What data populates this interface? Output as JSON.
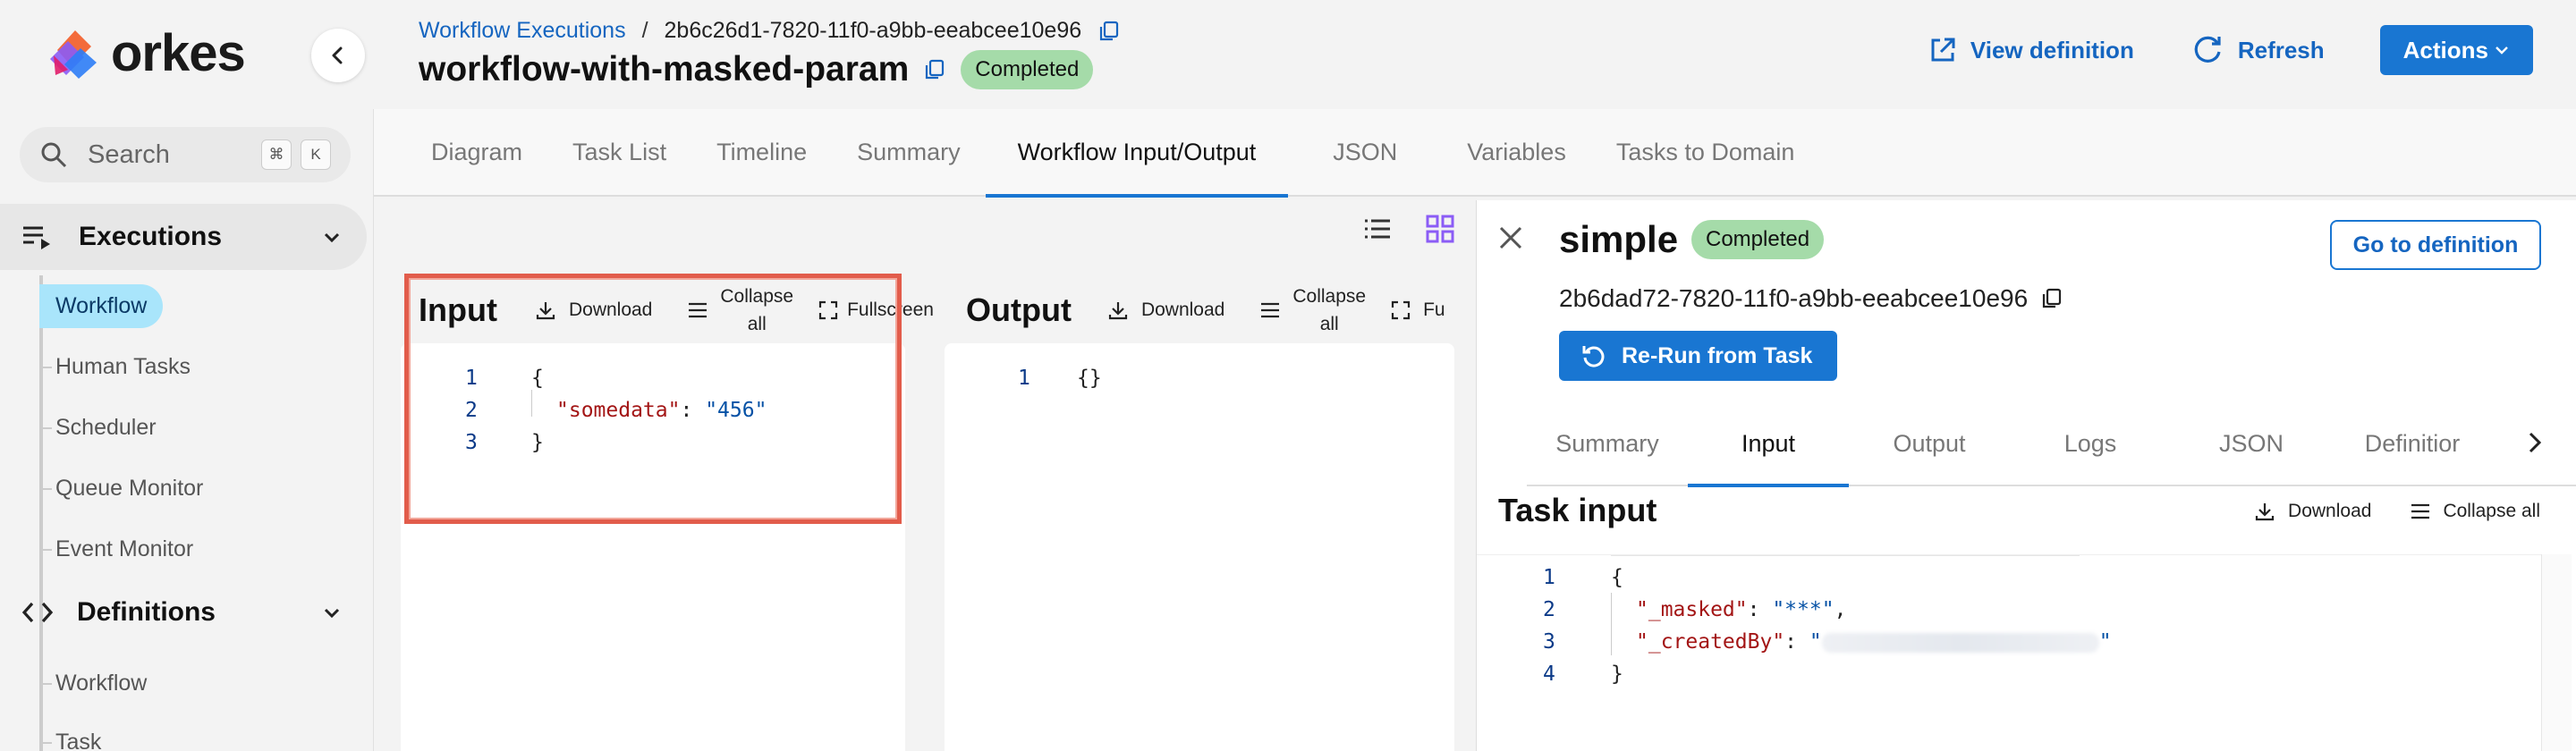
{
  "brand": {
    "name": "orkes"
  },
  "header": {
    "breadcrumb_link": "Workflow Executions",
    "breadcrumb_sep": "/",
    "workflow_id": "2b6c26d1-7820-11f0-a9bb-eeabcee10e96",
    "title": "workflow-with-masked-param",
    "status": "Completed",
    "view_definition": "View definition",
    "refresh": "Refresh",
    "actions": "Actions"
  },
  "sidebar": {
    "search_placeholder": "Search",
    "kbd_cmd": "⌘",
    "kbd_k": "K",
    "executions_label": "Executions",
    "executions_items": [
      "Workflow",
      "Human Tasks",
      "Scheduler",
      "Queue Monitor",
      "Event Monitor"
    ],
    "definitions_label": "Definitions",
    "definitions_items": [
      "Workflow",
      "Task"
    ]
  },
  "tabs": [
    "Diagram",
    "Task List",
    "Timeline",
    "Summary",
    "Workflow Input/Output",
    "JSON",
    "Variables",
    "Tasks to Domain"
  ],
  "input_pane": {
    "title": "Input",
    "download": "Download",
    "collapse_1": "Collapse",
    "collapse_2": "all",
    "fullscreen": "Fullscreen",
    "lines": {
      "n1": "1",
      "n2": "2",
      "n3": "3",
      "open": "{",
      "key": "\"somedata\"",
      "colon": ": ",
      "value": "\"456\"",
      "close": "}"
    }
  },
  "output_pane": {
    "title": "Output",
    "download": "Download",
    "collapse_1": "Collapse",
    "collapse_2": "all",
    "fullscreen": "Fu",
    "lines": {
      "n1": "1",
      "body": "{}"
    }
  },
  "drawer": {
    "task_name": "simple",
    "status": "Completed",
    "goto": "Go to definition",
    "task_id": "2b6dad72-7820-11f0-a9bb-eeabcee10e96",
    "rerun": "Re-Run from Task",
    "tabs": [
      "Summary",
      "Input",
      "Output",
      "Logs",
      "JSON",
      "Definitior"
    ],
    "section_title": "Task input",
    "download": "Download",
    "collapse": "Collapse all",
    "lines": {
      "n1": "1",
      "n2": "2",
      "n3": "3",
      "n4": "4",
      "open": "{",
      "key1": "\"_masked\"",
      "val1": "\"***\"",
      "key2": "\"_createdBy\"",
      "q": "\"",
      "close": "}"
    }
  },
  "colors": {
    "accent": "#1976d2",
    "status_green": "#a5dba9",
    "highlight": "#e25c4b",
    "active_nav": "#a9e5fb"
  }
}
